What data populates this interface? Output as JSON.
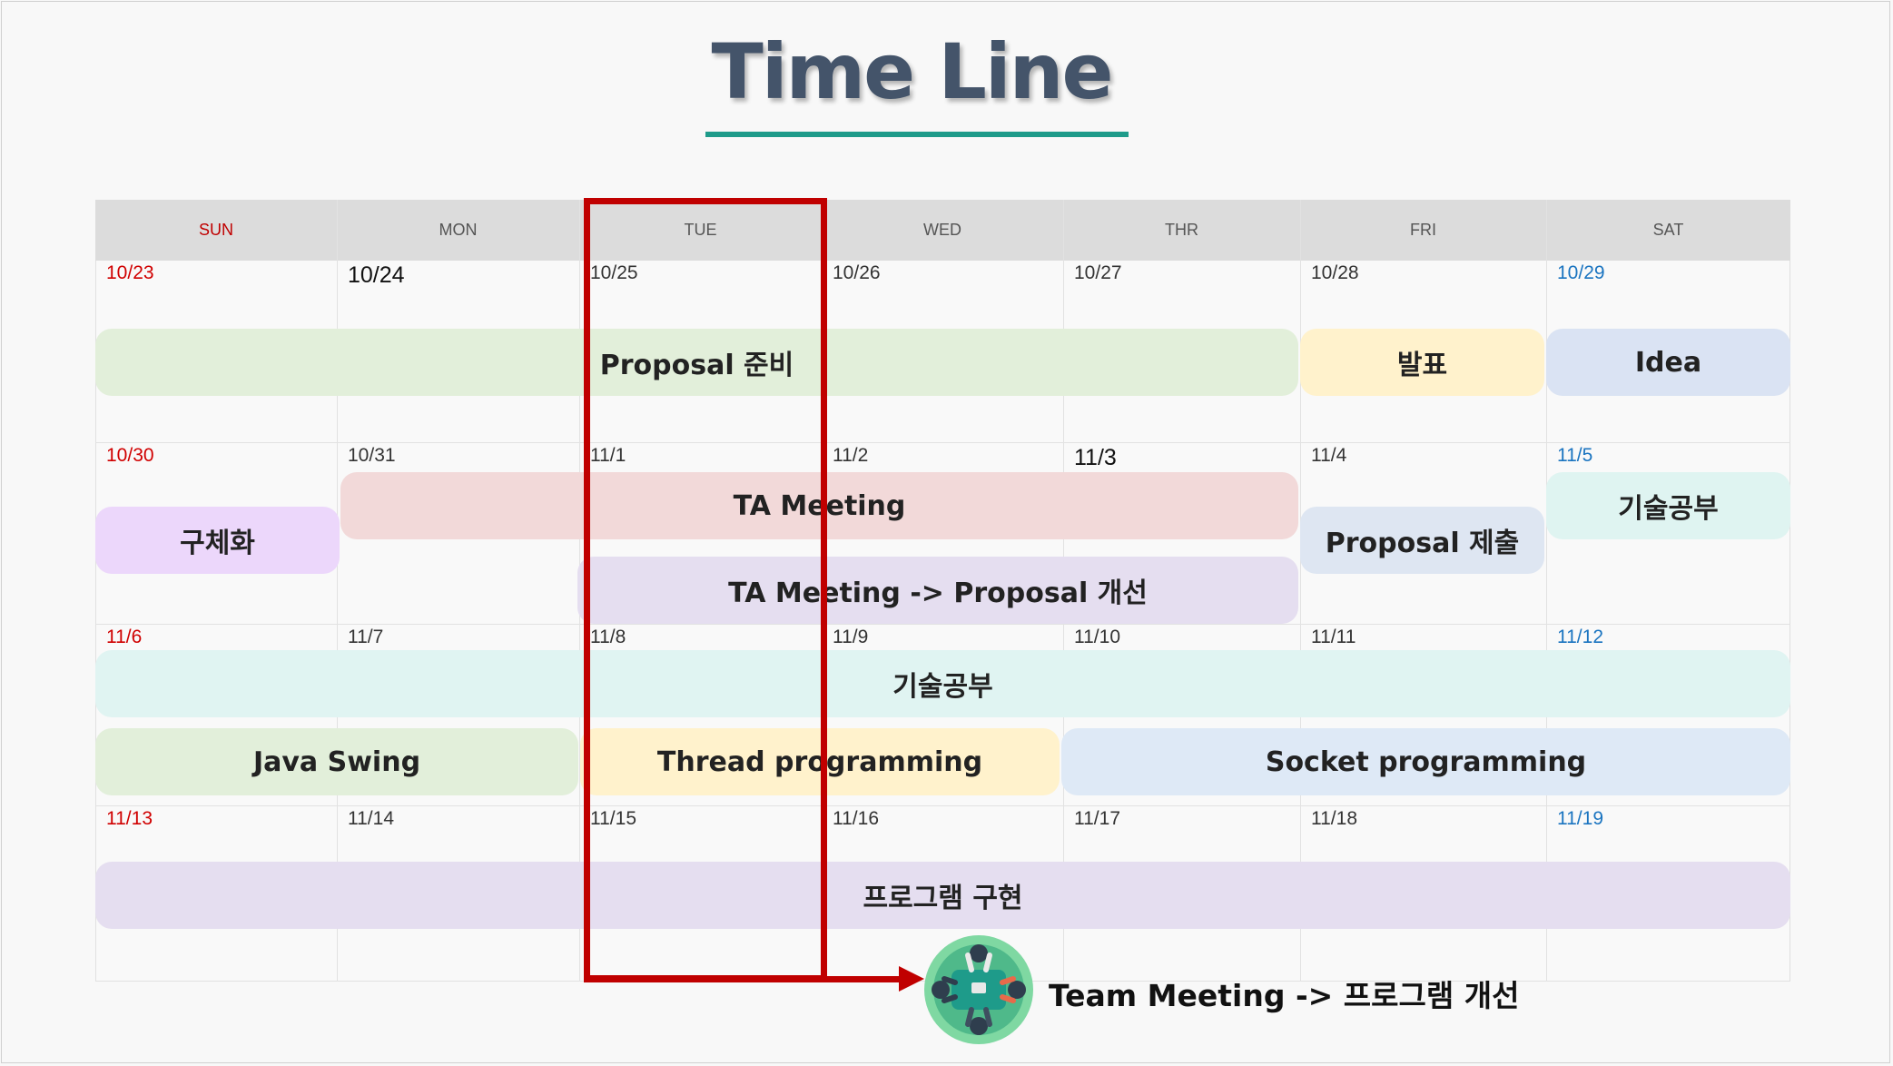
{
  "title": "Time Line",
  "days": [
    "SUN",
    "MON",
    "TUE",
    "WED",
    "THR",
    "FRI",
    "SAT"
  ],
  "weeks": [
    [
      "10/23",
      "10/24",
      "10/25",
      "10/26",
      "10/27",
      "10/28",
      "10/29"
    ],
    [
      "10/30",
      "10/31",
      "11/1",
      "11/2",
      "11/3",
      "11/4",
      "11/5"
    ],
    [
      "11/6",
      "11/7",
      "11/8",
      "11/9",
      "11/10",
      "11/11",
      "11/12"
    ],
    [
      "11/13",
      "11/14",
      "11/15",
      "11/16",
      "11/17",
      "11/18",
      "11/19"
    ]
  ],
  "events": {
    "proposal_prep": "Proposal 준비",
    "presentation": "발표",
    "idea": "Idea",
    "ta_meeting": "TA Meeting",
    "concretize": "구체화",
    "proposal_submit": "Proposal 제출",
    "tech_study_1": "기술공부",
    "ta_meeting_improve": "TA Meeting -> Proposal 개선",
    "tech_study_2": "기술공부",
    "java_swing": "Java Swing",
    "thread_programming": "Thread programming",
    "socket_programming": "Socket programming",
    "program_impl": "프로그램 구현"
  },
  "annotation": {
    "icon": "team-meeting-icon",
    "text": "Team Meeting -> 프로그램 개선"
  },
  "colors": {
    "title": "#44546a",
    "underline": "#1e9b8a",
    "highlight": "#c00000",
    "sunday": "#d00000",
    "saturday": "#1a74c0"
  }
}
